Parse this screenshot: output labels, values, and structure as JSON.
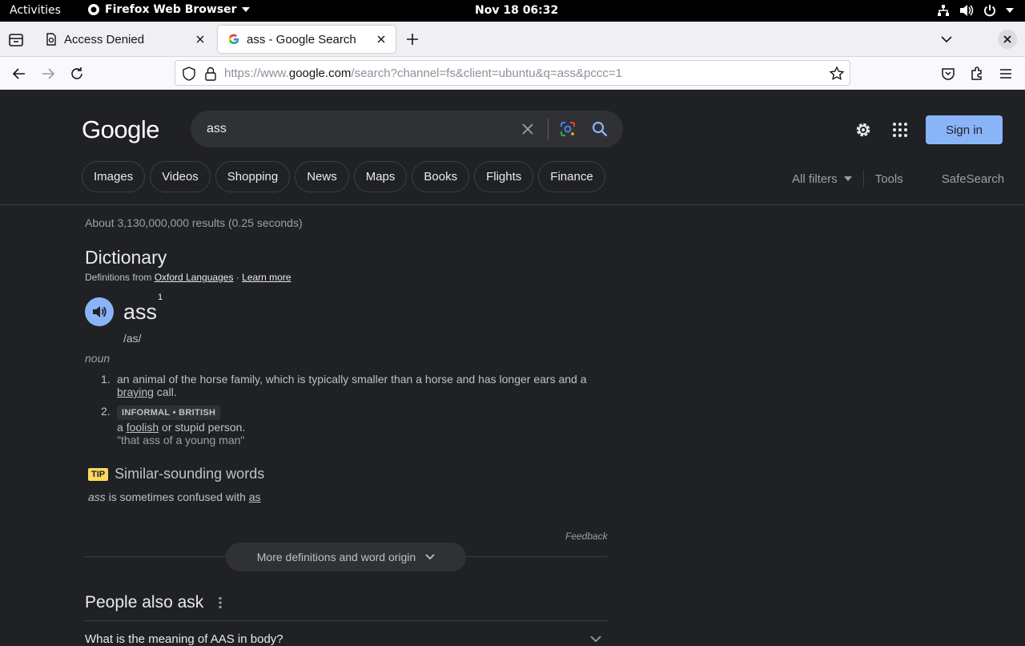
{
  "system_bar": {
    "activities": "Activities",
    "app_name": "Firefox Web Browser",
    "clock": "Nov 18  06:32"
  },
  "browser": {
    "tabs": [
      {
        "title": "Access Denied",
        "active": false,
        "icon": "page-warning-icon"
      },
      {
        "title": "ass - Google Search",
        "active": true,
        "icon": "google-g-icon"
      }
    ],
    "url_prefix": "https://www.",
    "url_domain": "google.com",
    "url_rest": "/search?channel=fs&client=ubuntu&q=ass&pccc=1"
  },
  "google": {
    "logo": "Google",
    "query": "ass",
    "sign_in": "Sign in",
    "chips": [
      "Images",
      "Videos",
      "Shopping",
      "News",
      "Maps",
      "Books",
      "Flights",
      "Finance"
    ],
    "all_filters": "All filters",
    "tools": "Tools",
    "safesearch": "SafeSearch",
    "stats": "About 3,130,000,000 results (0.25 seconds)"
  },
  "dictionary": {
    "title": "Dictionary",
    "source_prefix": "Definitions from",
    "source_link": "Oxford Languages",
    "source_sep": " · ",
    "learn_more": "Learn more",
    "word": "ass",
    "superscript": "1",
    "phonetic": "/as/",
    "part_of_speech": "noun",
    "definitions": [
      {
        "num": "1.",
        "text_before": "an animal of the horse family, which is typically smaller than a horse and has longer ears and a ",
        "link": "braying",
        "text_after": " call."
      },
      {
        "num": "2.",
        "badge": "INFORMAL • BRITISH",
        "text_before": "a ",
        "link": "foolish",
        "text_after": " or stupid person.",
        "example": "\"that ass of a young man\""
      }
    ],
    "tip_badge": "TIP",
    "tip_title": "Similar-sounding words",
    "confuse_word": "ass",
    "confuse_text": " is sometimes confused with ",
    "confuse_link": "as",
    "feedback": "Feedback",
    "more_button": "More definitions and word origin"
  },
  "people_also_ask": {
    "title": "People also ask",
    "questions": [
      "What is the meaning of AAS in body?"
    ]
  },
  "colors": {
    "page_bg": "#202124",
    "accent_blue": "#8ab4f8",
    "tip_yellow": "#fdd663"
  }
}
